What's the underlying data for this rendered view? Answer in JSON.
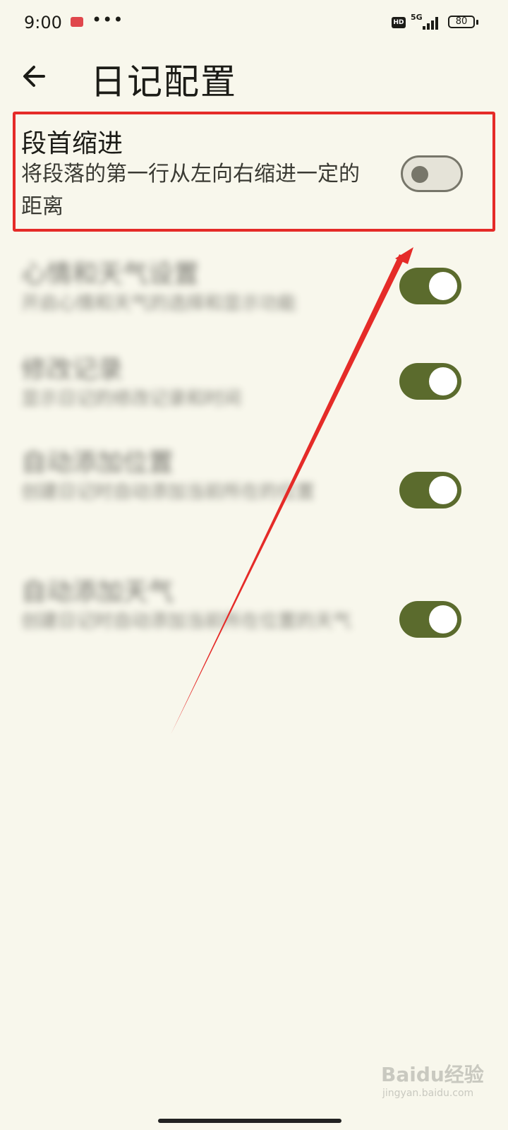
{
  "status_bar": {
    "time": "9:00",
    "more": "•••",
    "hd": "HD",
    "network": "5G",
    "battery": "80"
  },
  "header": {
    "back_icon": "arrow-left-icon",
    "title": "日记配置"
  },
  "settings": [
    {
      "title": "段首缩进",
      "description": "将段落的第一行从左向右缩进一定的距离",
      "enabled": false
    },
    {
      "title": "心情和天气设置",
      "description": "开启心情和天气的选择和显示功能",
      "enabled": true
    },
    {
      "title": "修改记录",
      "description": "显示日记的修改记录和时间",
      "enabled": true
    },
    {
      "title": "自动添加位置",
      "description": "创建日记时自动添加当前所在的位置",
      "enabled": true
    },
    {
      "title": "自动添加天气",
      "description": "创建日记时自动添加当前所在位置的天气",
      "enabled": true
    }
  ],
  "colors": {
    "background": "#f8f7ec",
    "toggle_on": "#5b6b2d",
    "highlight": "#e52b28"
  },
  "watermark": {
    "main": "Baidu经验",
    "sub": "jingyan.baidu.com"
  }
}
